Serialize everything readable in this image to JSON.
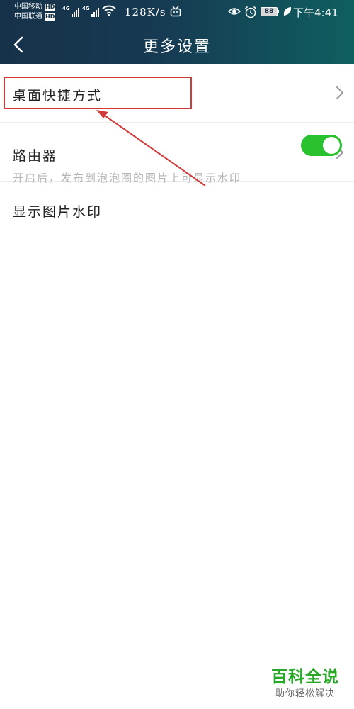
{
  "status_bar": {
    "carrier_1": "中国移动",
    "carrier_2": "中国联通",
    "hd_badge": "HD",
    "network_type": "4G",
    "net_speed": "128K/s",
    "battery_level": "88",
    "time": "下午4:41",
    "icons": [
      "signal-icon",
      "wifi-icon",
      "tv-icon",
      "eye-icon",
      "alarm-icon",
      "battery-icon",
      "leaf-icon"
    ]
  },
  "app_bar": {
    "title": "更多设置",
    "back_icon": "chevron-left-icon"
  },
  "settings": {
    "desktop_shortcut": {
      "label": "桌面快捷方式",
      "icon": "chevron-right-icon"
    },
    "router": {
      "label": "路由器",
      "icon": "chevron-right-icon"
    },
    "watermark_toggle": {
      "label": "显示图片水印",
      "enabled": true,
      "hint": "开启后，发布到泡泡圈的图片上可显示水印"
    }
  },
  "watermark": {
    "title": "百科全说",
    "subtitle": "助你轻松解决"
  },
  "colors": {
    "header_gradient_start": "#16324a",
    "header_gradient_end": "#0f5f60",
    "toggle_on": "#29c12d",
    "annotation_red": "#d23a3a",
    "watermark_green": "#27a927"
  }
}
